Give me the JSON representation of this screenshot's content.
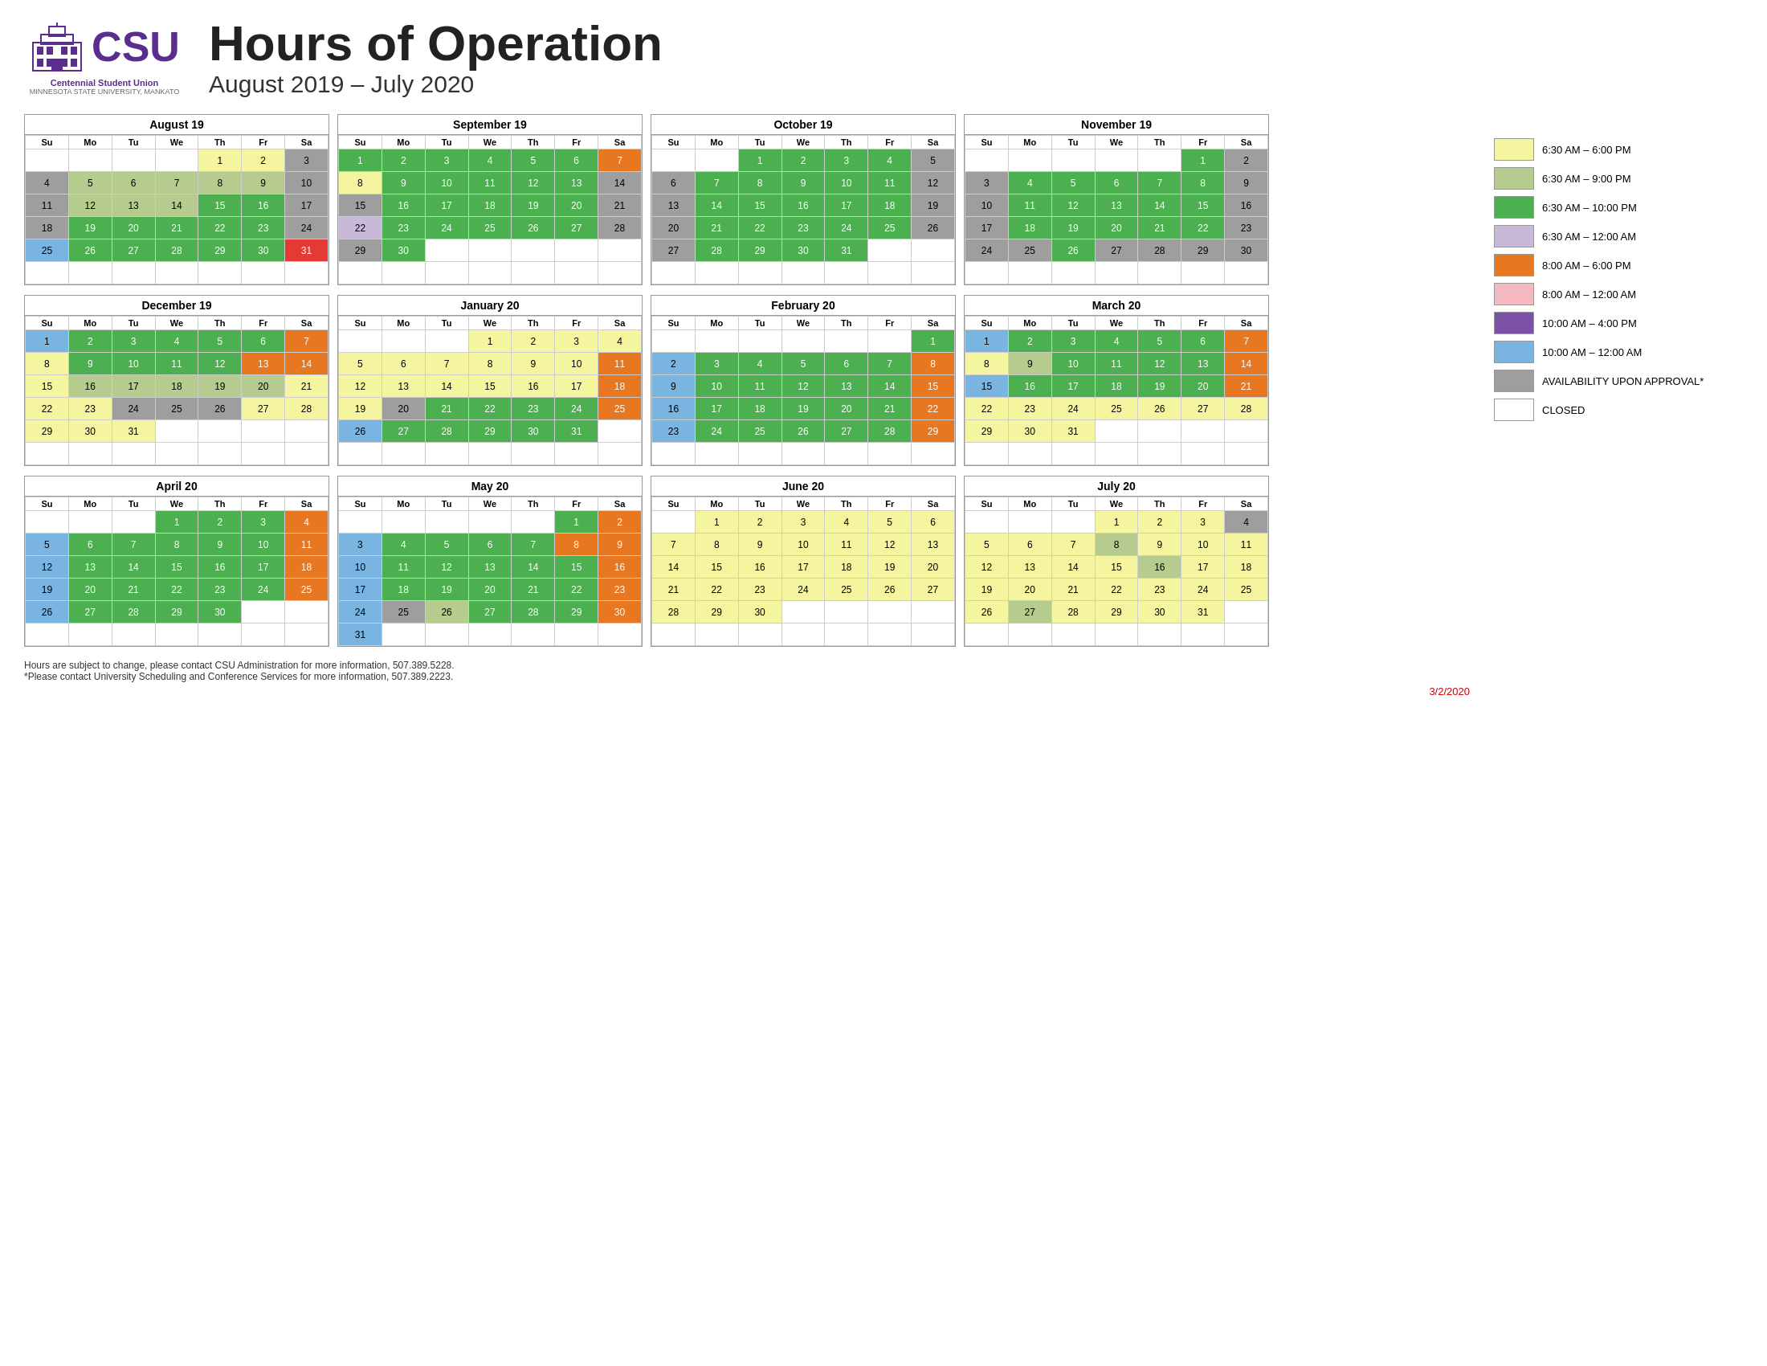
{
  "header": {
    "org_name": "Centennial Student Union",
    "org_sub": "MINNESOTA STATE UNIVERSITY, MANKATO",
    "title": "Hours of Operation",
    "subtitle": "August 2019 – July 2020"
  },
  "legend": [
    {
      "color": "c-yellow",
      "label": "6:30 AM – 6:00 PM"
    },
    {
      "color": "c-light-green",
      "label": "6:30 AM – 9:00 PM"
    },
    {
      "color": "c-green",
      "label": "6:30 AM – 10:00 PM"
    },
    {
      "color": "c-lavender",
      "label": "6:30 AM – 12:00 AM"
    },
    {
      "color": "c-orange",
      "label": "8:00 AM – 6:00 PM"
    },
    {
      "color": "c-pink",
      "label": "8:00 AM – 12:00 AM"
    },
    {
      "color": "c-purple",
      "label": "10:00 AM – 4:00 PM"
    },
    {
      "color": "c-blue",
      "label": "10:00 AM – 12:00 AM"
    },
    {
      "color": "c-gray",
      "label": "AVAILABILITY UPON APPROVAL*"
    },
    {
      "color": "c-white",
      "label": "CLOSED"
    }
  ],
  "footer": {
    "line1": "Hours are subject to change, please contact CSU Administration for more information, 507.389.5228.",
    "line2": "*Please contact University Scheduling and Conference Services for more information, 507.389.2223.",
    "date": "3/2/2020"
  },
  "calendars": {
    "aug19": {
      "title": "August 19"
    },
    "sep19": {
      "title": "September 19"
    },
    "oct19": {
      "title": "October 19"
    },
    "nov19": {
      "title": "November 19"
    },
    "dec19": {
      "title": "December 19"
    },
    "jan20": {
      "title": "January 20"
    },
    "feb20": {
      "title": "February 20"
    },
    "mar20": {
      "title": "March 20"
    },
    "apr20": {
      "title": "April 20"
    },
    "may20": {
      "title": "May 20"
    },
    "jun20": {
      "title": "June 20"
    },
    "jul20": {
      "title": "July 20"
    }
  }
}
